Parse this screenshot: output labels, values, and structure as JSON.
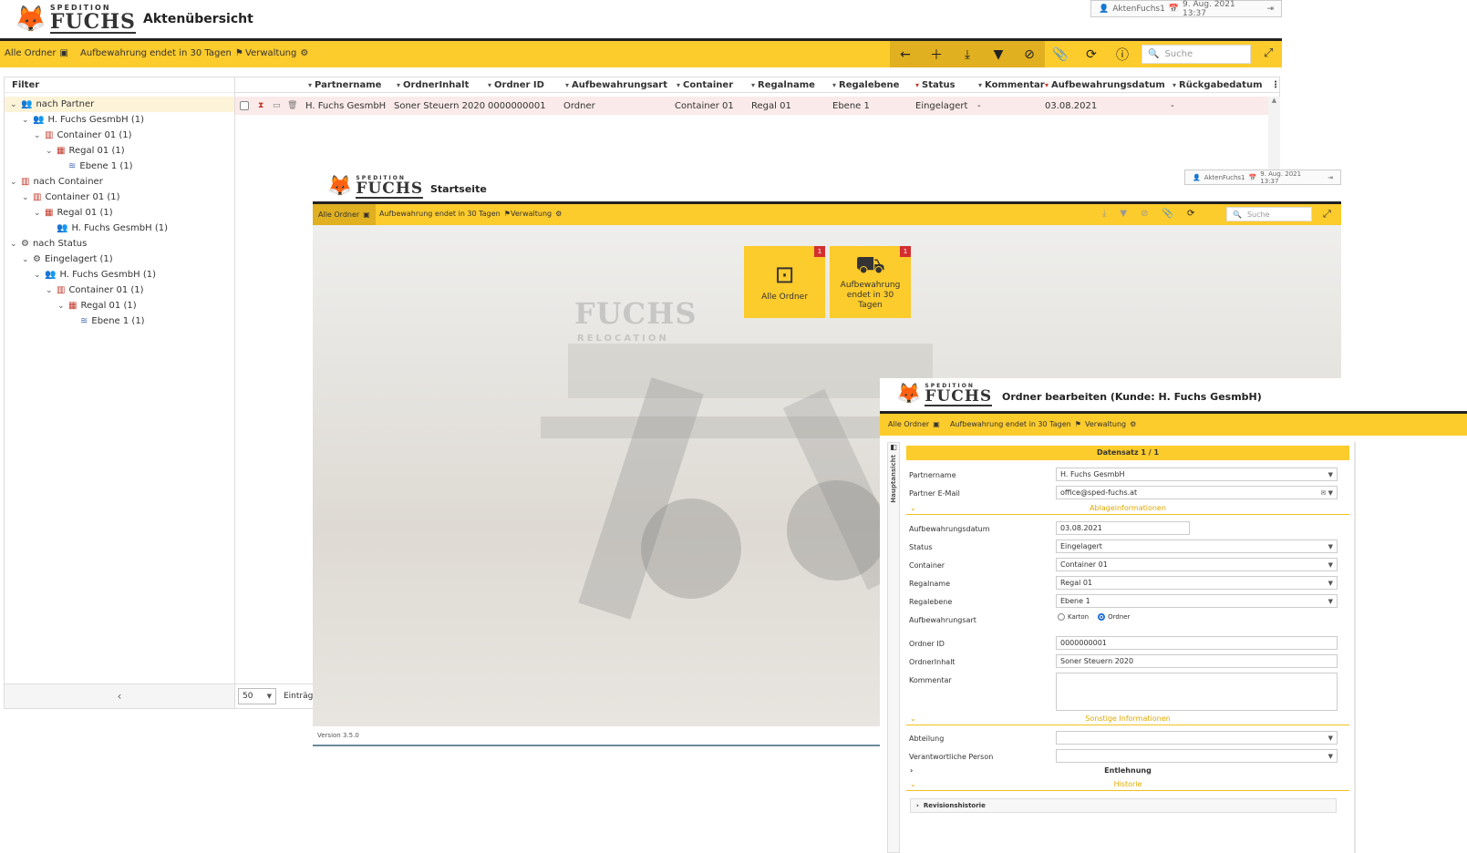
{
  "w1": {
    "logo_small": "SPEDITION",
    "logo_big": "FUCHS",
    "title": "Aktenübersicht",
    "user": "AktenFuchs1",
    "datetime": "9. Aug. 2021 13:37",
    "nav": [
      "Alle Ordner",
      "Aufbewahrung endet in 30 Tagen",
      "Verwaltung"
    ],
    "search_placeholder": "Suche",
    "filter_label": "Filter",
    "tree": [
      {
        "label": "nach Partner",
        "level": 0,
        "icon": "users-icon"
      },
      {
        "label": "H. Fuchs GesmbH (1)",
        "level": 1,
        "icon": "users-icon"
      },
      {
        "label": "Container 01 (1)",
        "level": 2,
        "icon": "container-icon"
      },
      {
        "label": "Regal 01 (1)",
        "level": 3,
        "icon": "shelf-icon"
      },
      {
        "label": "Ebene 1 (1)",
        "level": 4,
        "icon": "layers-icon"
      },
      {
        "label": "nach Container",
        "level": 0,
        "icon": "container-icon"
      },
      {
        "label": "Container 01 (1)",
        "level": 1,
        "icon": "container-icon"
      },
      {
        "label": "Regal 01 (1)",
        "level": 2,
        "icon": "shelf-icon"
      },
      {
        "label": "H. Fuchs GesmbH (1)",
        "level": 3,
        "icon": "users-icon"
      },
      {
        "label": "nach Status",
        "level": 0,
        "icon": "gear-icon"
      },
      {
        "label": "Eingelagert (1)",
        "level": 1,
        "icon": "gear-icon"
      },
      {
        "label": "H. Fuchs GesmbH (1)",
        "level": 2,
        "icon": "users-icon"
      },
      {
        "label": "Container 01 (1)",
        "level": 3,
        "icon": "container-icon"
      },
      {
        "label": "Regal 01 (1)",
        "level": 4,
        "icon": "shelf-icon"
      },
      {
        "label": "Ebene 1 (1)",
        "level": 5,
        "icon": "layers-icon"
      }
    ],
    "columns": [
      "Partnername",
      "OrdnerInhalt",
      "Ordner ID",
      "Aufbewahrungsart",
      "Container",
      "Regalname",
      "Regalebene",
      "Status",
      "Kommentar",
      "Aufbewahrungsdatum",
      "Rückgabedatum"
    ],
    "row": [
      "H. Fuchs GesmbH",
      "Soner Steuern 2020",
      "0000000001",
      "Ordner",
      "Container 01",
      "Regal 01",
      "Ebene 1",
      "Eingelagert",
      "-",
      "03.08.2021",
      "-"
    ],
    "page_size": "50",
    "entries_label": "Einträge",
    "collapse_arrow": "‹"
  },
  "w2": {
    "logo_small": "SPEDITION",
    "logo_big": "FUCHS",
    "title": "Startseite",
    "user": "AktenFuchs1",
    "datetime": "9. Aug. 2021 13:37",
    "nav": [
      "Alle Ordner",
      "Aufbewahrung endet in 30 Tagen",
      "Verwaltung"
    ],
    "search_placeholder": "Suche",
    "tiles": [
      {
        "label": "Alle Ordner",
        "badge": "1"
      },
      {
        "label": "Aufbewahrung endet in 30 Tagen",
        "badge": "1"
      }
    ],
    "bg_brand": "FUCHS",
    "bg_sub": "RELOCATION",
    "version": "Version 3.5.0"
  },
  "w3": {
    "logo_small": "SPEDITION",
    "logo_big": "FUCHS",
    "title": "Ordner bearbeiten (Kunde: H. Fuchs GesmbH)",
    "nav": [
      "Alle Ordner",
      "Aufbewahrung endet in 30 Tagen",
      "Verwaltung"
    ],
    "side_tab": "Hauptansicht",
    "record_label": "Datensatz  1 / 1",
    "fields": {
      "partnername_label": "Partnername",
      "partnername": "H. Fuchs GesmbH",
      "email_label": "Partner E-Mail",
      "email": "office@sped-fuchs.at",
      "section_ablage": "Ablageinformationen",
      "aufbewahrungsdatum_label": "Aufbewahrungsdatum",
      "aufbewahrungsdatum": "03.08.2021",
      "status_label": "Status",
      "status": "Eingelagert",
      "container_label": "Container",
      "container": "Container 01",
      "regalname_label": "Regalname",
      "regalname": "Regal 01",
      "regalebene_label": "Regalebene",
      "regalebene": "Ebene 1",
      "art_label": "Aufbewahrungsart",
      "art_opt1": "Karton",
      "art_opt2": "Ordner",
      "ordner_id_label": "Ordner ID",
      "ordner_id": "0000000001",
      "inhalt_label": "OrdnerInhalt",
      "inhalt": "Soner Steuern 2020",
      "kommentar_label": "Kommentar",
      "section_sonstige": "Sonstige Informationen",
      "abteilung_label": "Abteilung",
      "person_label": "Verantwortliche Person",
      "section_entlehnung": "Entlehnung",
      "section_historie": "Historie",
      "revision_label": "Revisionshistorie"
    }
  },
  "colors": {
    "accent": "#fccb2c",
    "dark": "#222222",
    "badge": "#d32f2f",
    "row_highlight": "#fbeaea"
  }
}
